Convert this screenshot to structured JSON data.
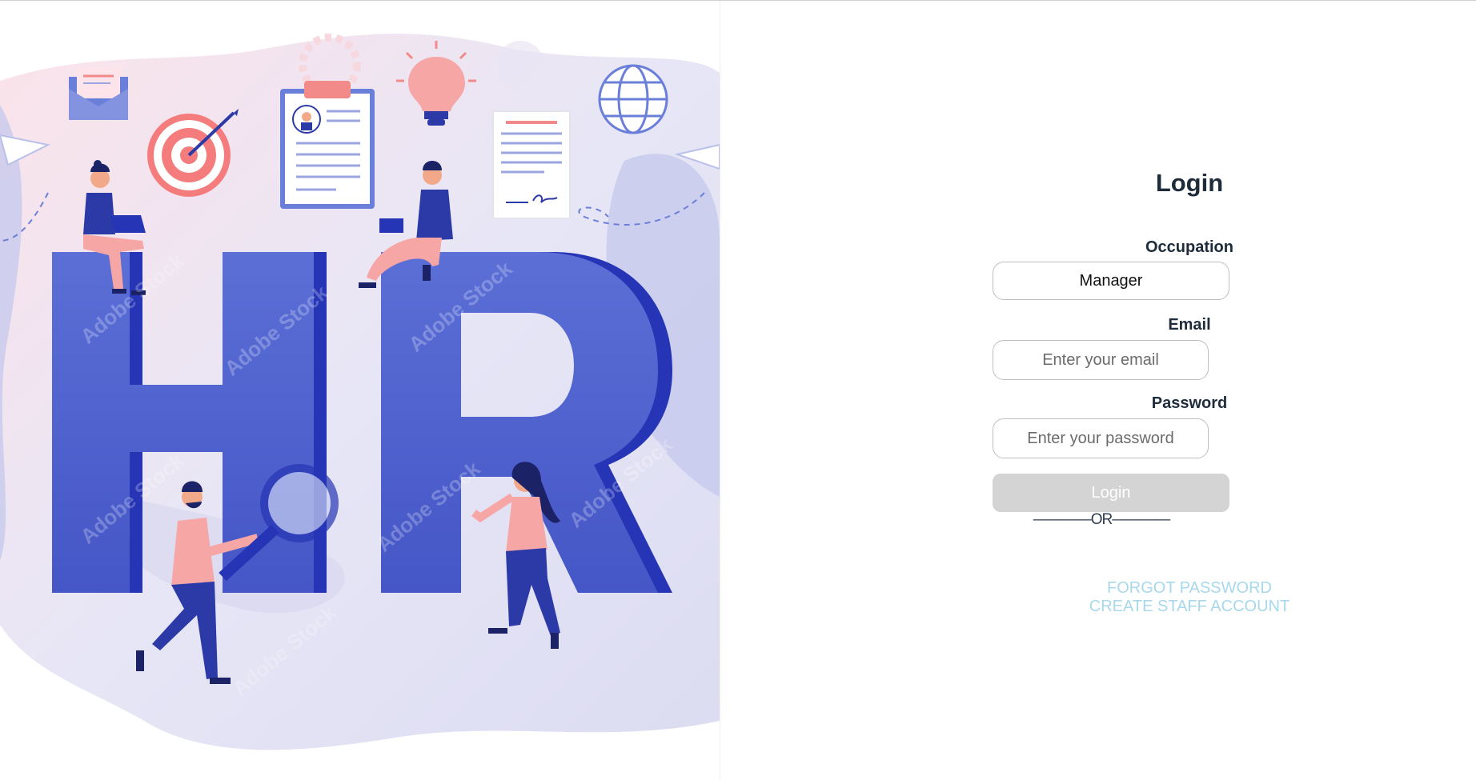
{
  "illustration": {
    "hero_letters": "HR",
    "watermark": "Adobe Stock"
  },
  "login": {
    "title": "Login",
    "occupation_label": "Occupation",
    "occupation_value": "Manager",
    "email_label": "Email",
    "email_placeholder": "Enter your email",
    "password_label": "Password",
    "password_placeholder": "Enter your password",
    "login_button": "Login",
    "or_divider": "————OR————",
    "forgot_password": "FORGOT PASSWORD",
    "create_account": "CREATE STAFF ACCOUNT"
  },
  "colors": {
    "title_text": "#1e2b3a",
    "button_bg": "#d4d4d4",
    "link": "#a8d8ec",
    "hr_blue": "#4a5ecb",
    "hr_dark_blue": "#2535b5",
    "accent_coral": "#f28a8a"
  }
}
